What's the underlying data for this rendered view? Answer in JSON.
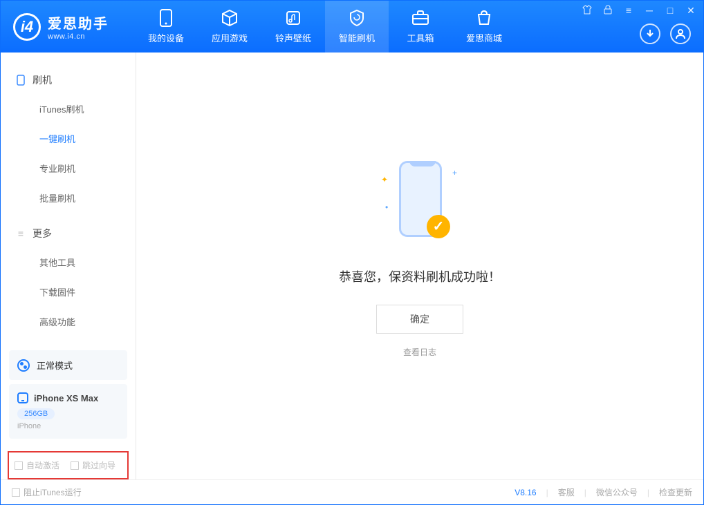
{
  "header": {
    "logo_title": "爱思助手",
    "logo_sub": "www.i4.cn",
    "tabs": [
      {
        "label": "我的设备",
        "icon": "device"
      },
      {
        "label": "应用游戏",
        "icon": "cube"
      },
      {
        "label": "铃声壁纸",
        "icon": "music"
      },
      {
        "label": "智能刷机",
        "icon": "shield",
        "active": true
      },
      {
        "label": "工具箱",
        "icon": "toolbox"
      },
      {
        "label": "爱思商城",
        "icon": "shop"
      }
    ],
    "win_icons": [
      "shirt-icon",
      "lock-icon",
      "menu-icon",
      "minimize-icon",
      "maximize-icon",
      "close-icon"
    ],
    "right_icons": [
      "download-icon",
      "user-icon"
    ]
  },
  "sidebar": {
    "sections": [
      {
        "title": "刷机",
        "icon": "phone-icon",
        "items": [
          {
            "label": "iTunes刷机"
          },
          {
            "label": "一键刷机",
            "active": true
          },
          {
            "label": "专业刷机"
          },
          {
            "label": "批量刷机"
          }
        ]
      },
      {
        "title": "更多",
        "icon": "more-icon",
        "items": [
          {
            "label": "其他工具"
          },
          {
            "label": "下载固件"
          },
          {
            "label": "高级功能"
          }
        ]
      }
    ],
    "mode_label": "正常模式",
    "device": {
      "name": "iPhone XS Max",
      "capacity": "256GB",
      "type": "iPhone"
    },
    "checkbox_auto": "自动激活",
    "checkbox_skip": "跳过向导"
  },
  "main": {
    "success_text": "恭喜您，保资料刷机成功啦！",
    "ok_button": "确定",
    "view_log": "查看日志"
  },
  "footer": {
    "block_itunes": "阻止iTunes运行",
    "version": "V8.16",
    "links": [
      "客服",
      "微信公众号",
      "检查更新"
    ]
  }
}
